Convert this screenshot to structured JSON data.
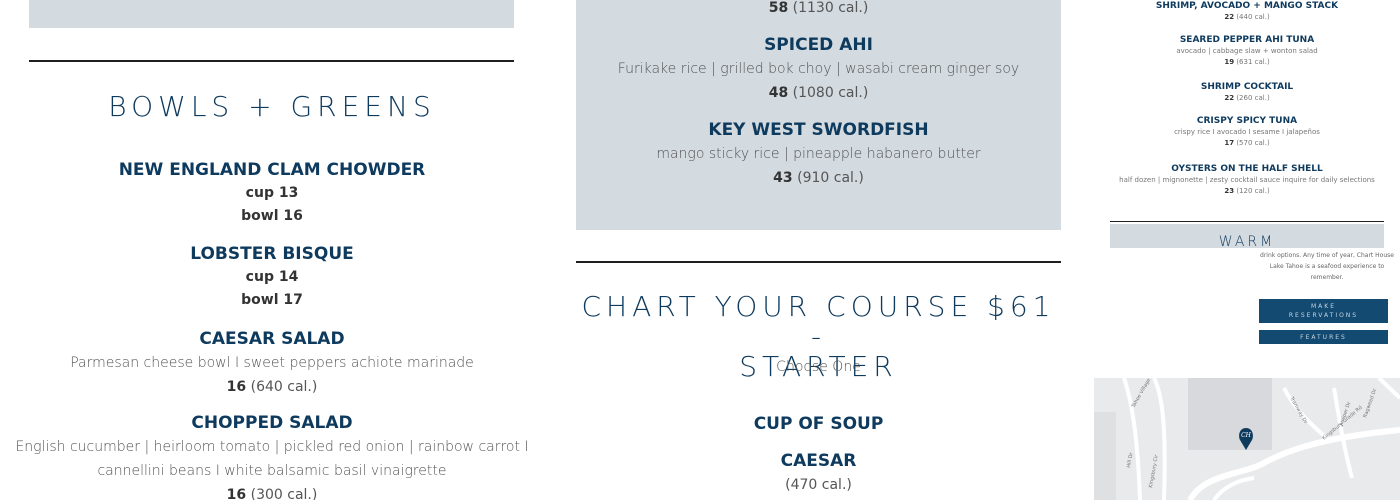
{
  "left": {
    "section_title": "BOWLS + GREENS",
    "items": [
      {
        "name": "NEW ENGLAND CLAM CHOWDER",
        "lines": [
          "cup 13",
          "bowl 16"
        ]
      },
      {
        "name": "LOBSTER BISQUE",
        "lines": [
          "cup 14",
          "bowl 17"
        ]
      },
      {
        "name": "CAESAR SALAD",
        "desc": "Parmesan cheese bowl I sweet peppers achiote marinade",
        "price": "16",
        "cal": "(640 cal.)"
      },
      {
        "name": "CHOPPED SALAD",
        "desc": "English cucumber | heirloom tomato | pickled red onion | rainbow carrot I",
        "desc2": "cannellini beans I white balsamic basil vinaigrette",
        "price": "16",
        "cal": "(300 cal.)"
      }
    ]
  },
  "middle": {
    "top_price": {
      "price": "58",
      "cal": "(1130 cal.)"
    },
    "items": [
      {
        "name": "SPICED AHI",
        "desc": "Furikake rice | grilled bok choy | wasabi cream ginger soy",
        "price": "48",
        "cal": "(1080 cal.)"
      },
      {
        "name": "KEY WEST SWORDFISH",
        "desc": "mango sticky rice | pineapple habanero butter",
        "price": "43",
        "cal": "(910 cal.)"
      }
    ],
    "section_title_line1": "CHART YOUR COURSE $61 -",
    "section_title_line2": "STARTER",
    "section_subtitle": "Choose One",
    "course_items": [
      {
        "name": "CUP OF SOUP"
      },
      {
        "name": "CAESAR",
        "cal": "(470 cal.)"
      }
    ]
  },
  "right": {
    "items": [
      {
        "name": "SHRIMP, AVOCADO + MANGO STACK",
        "price": "22",
        "cal": "(440 cal.)"
      },
      {
        "name": "SEARED PEPPER AHI TUNA",
        "desc": "avocado | cabbage slaw + wonton salad",
        "price": "19",
        "cal": "(631 cal.)"
      },
      {
        "name": "SHRIMP COCKTAIL",
        "price": "22",
        "cal": "(260 cal.)"
      },
      {
        "name": "CRISPY SPICY TUNA",
        "desc": "crispy rice I avocado I sesame I jalapeños",
        "price": "17",
        "cal": "(570 cal.)"
      },
      {
        "name": "OYSTERS ON THE HALF SHELL",
        "desc": "half dozen | mignonette | zesty cocktail sauce inquire for daily selections",
        "price": "23",
        "cal": "(120 cal.)"
      }
    ],
    "warm_label": "WARM",
    "promo_text_1": "drink options. Any time of year, Chart House",
    "promo_text_2": "Lake Tahoe is a seafood experience to",
    "promo_text_3": "remember.",
    "make_reservations_1": "MAKE",
    "make_reservations_2": "RESERVATIONS",
    "features_label": "FEATURES",
    "map": {
      "pin_icon": "map-pin-icon",
      "street_labels": [
        "Kingsbury Grade Rd",
        "Tramway Dr",
        "Hill Dr",
        "Kingsbury Cir",
        "Juniper Dr",
        "Ragweed Dr",
        "Tahoe Village Blvd"
      ]
    }
  },
  "colors": {
    "navy": "#0e3a5e",
    "grey_panel": "#d3dae0",
    "button": "#134a72"
  }
}
